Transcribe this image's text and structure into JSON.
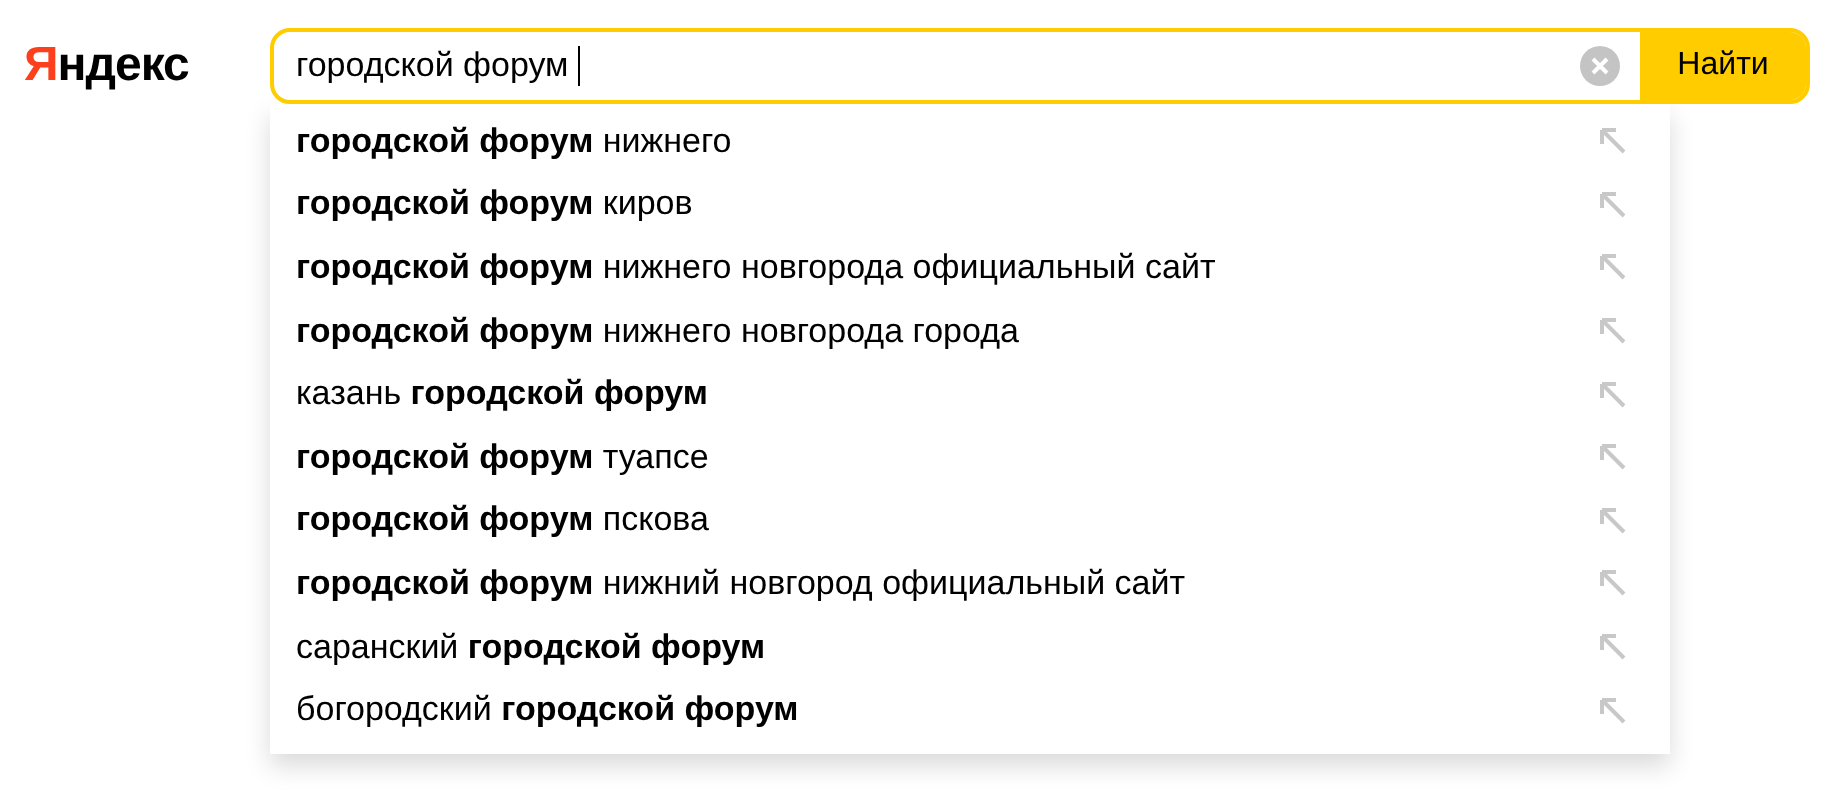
{
  "logo": {
    "accent": "Я",
    "text": "ндекс"
  },
  "search": {
    "value": "городской форум ",
    "button": "Найти"
  },
  "suggestions": [
    {
      "text": "**городской форум** нижнего"
    },
    {
      "text": "**городской форум** киров"
    },
    {
      "text": "**городской форум** нижнего новгорода официальный сайт"
    },
    {
      "text": "**городской форум** нижнего новгорода города"
    },
    {
      "text": "казань **городской форум**"
    },
    {
      "text": "**городской форум** туапсе"
    },
    {
      "text": "**городской форум** пскова"
    },
    {
      "text": "**городской форум** нижний новгород официальный сайт"
    },
    {
      "text": "саранский **городской форум**"
    },
    {
      "text": "богородский **городской форум**"
    }
  ]
}
